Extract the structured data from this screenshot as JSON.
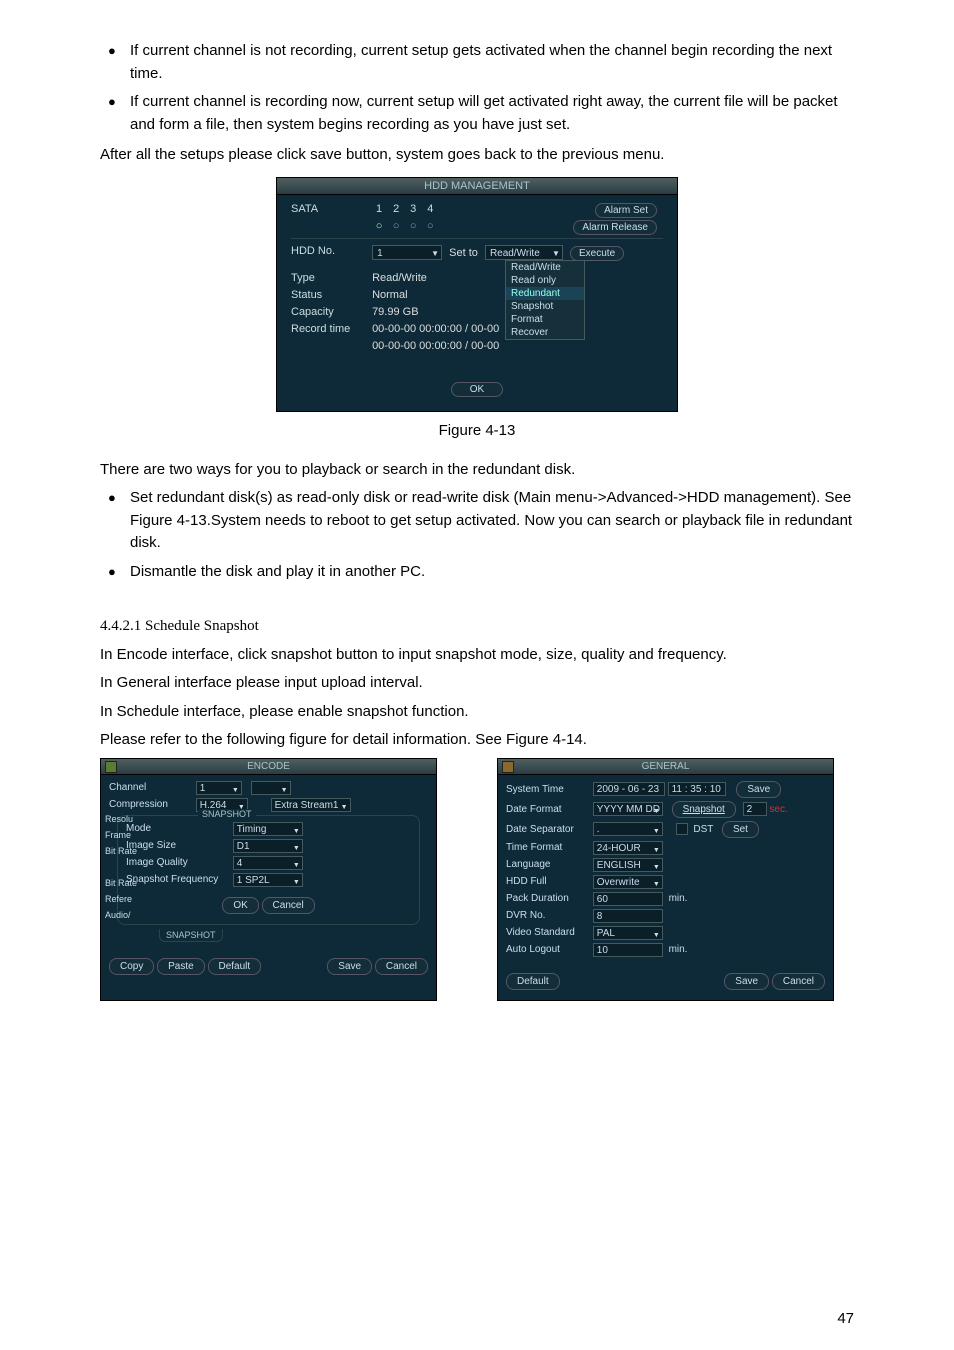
{
  "bullets_top": [
    "If current channel is not recording, current setup gets activated when the channel begin recording the next time.",
    "If current channel is recording now, current setup will get activated right away, the current file will be packet and form a file, then system begins recording as you have just set."
  ],
  "after_bullets": "After all the setups please click save button, system goes back to the previous menu.",
  "figure_caption": "Figure 4-13",
  "para2": "There are two ways for you to playback or search in the redundant disk.",
  "bullets_mid": [
    "Set redundant disk(s) as read-only disk or read-write disk (Main menu->Advanced->HDD management).  See Figure 4-13.System needs to reboot to get setup activated. Now you can search or playback file in redundant disk.",
    "Dismantle the disk and play it in another PC."
  ],
  "section": "4.4.2.1 Schedule Snapshot",
  "para_s1": "In Encode interface, click snapshot button to input snapshot mode, size, quality and frequency.",
  "para_s2": "In General interface please input upload interval.",
  "para_s3": "In Schedule interface, please enable snapshot function.",
  "para_s4": "Please refer to the following figure for detail information. See Figure 4-14.",
  "pagenum": "47",
  "hdd": {
    "title": "HDD MANAGEMENT",
    "sata": "SATA",
    "s1": "1",
    "s2": "2",
    "s3": "3",
    "s4": "4",
    "alarm_set": "Alarm Set",
    "alarm_release": "Alarm Release",
    "hdd_no": "HDD No.",
    "hdd_no_val": "1",
    "set_to": "Set to",
    "set_to_val": "Read/Write",
    "execute": "Execute",
    "dd1": "Read/Write",
    "dd2": "Read only",
    "dd3": "Redundant",
    "dd4": "Snapshot",
    "dd5": "Format",
    "dd6": "Recover",
    "type": "Type",
    "type_val": "Read/Write",
    "status": "Status",
    "status_val": "Normal",
    "capacity": "Capacity",
    "capacity_val": "79.99 GB",
    "record_time": "Record time",
    "rt1": "00-00-00 00:00:00 / 00-00",
    "rt2": "00-00-00 00:00:00 / 00-00",
    "ok": "OK"
  },
  "enc": {
    "title": "ENCODE",
    "channel": "Channel",
    "channel_val": "1",
    "compression": "Compression",
    "comp_val": "H.264",
    "extra": "Extra Stream1",
    "resol": "Resolu",
    "snapshot_title": "SNAPSHOT",
    "frame": "Frame",
    "mode_l": "Mode",
    "mode": "Timing",
    "bitrate": "Bit Rate",
    "size_l": "Image Size",
    "size": "D1",
    "qual_l": "Image Quality",
    "quality": "4",
    "bitrate2": "Bit Rate",
    "freq_l": "Snapshot Frequency",
    "freq": "1 SP2L",
    "refer": "Refere",
    "audio": "Audio/",
    "ok": "OK",
    "cancel": "Cancel",
    "tab": "SNAPSHOT",
    "copy": "Copy",
    "paste": "Paste",
    "default": "Default",
    "save": "Save",
    "cancel2": "Cancel"
  },
  "gen": {
    "title": "GENERAL",
    "system_time": "System Time",
    "st_date": "2009 - 06 - 23",
    "st_time": "11 : 35 : 10",
    "save": "Save",
    "date_format": "Date Format",
    "df_val": "YYYY MM DD",
    "snapshot": "Snapshot",
    "snap_num": "2",
    "sec": "sec.",
    "date_sep": "Date Separator",
    "sep_val": ".",
    "dst": "DST",
    "set": "Set",
    "time_format": "Time Format",
    "tf_val": "24-HOUR",
    "language": "Language",
    "lang_val": "ENGLISH",
    "hdd_full": "HDD Full",
    "hf_val": "Overwrite",
    "pack_dur": "Pack Duration",
    "pd_val": "60",
    "min": "min.",
    "dvr_no": "DVR No.",
    "dvr_val": "8",
    "vstd": "Video Standard",
    "vstd_val": "PAL",
    "auto_logout": "Auto Logout",
    "al_val": "10",
    "min2": "min.",
    "default": "Default",
    "save2": "Save",
    "cancel": "Cancel"
  }
}
